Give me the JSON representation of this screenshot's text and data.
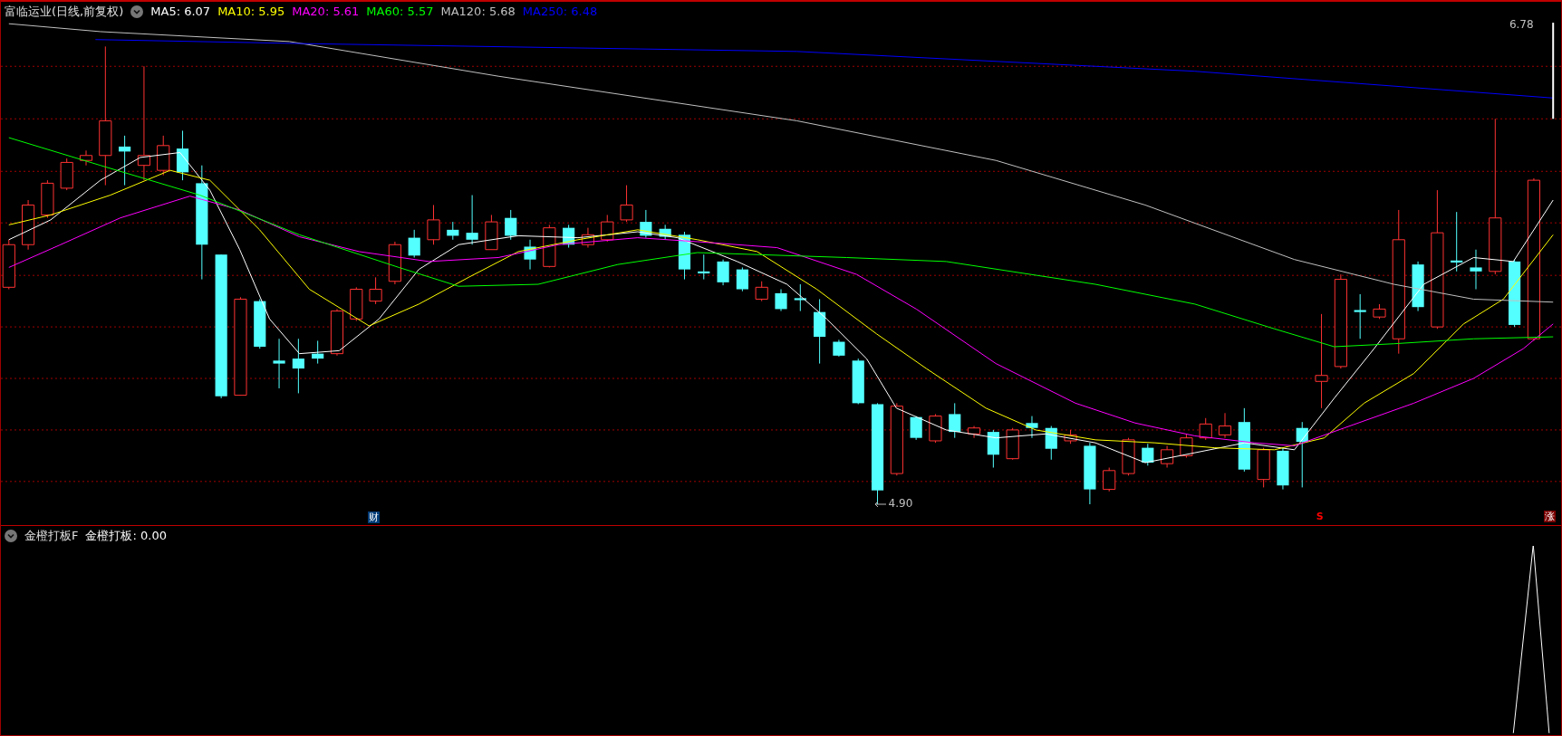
{
  "price_panel": {
    "title": "富临运业(日线,前复权)",
    "moving_averages": [
      {
        "label": "MA5: 6.07",
        "color": "#ffffff"
      },
      {
        "label": "MA10: 5.95",
        "color": "#ffff00"
      },
      {
        "label": "MA20: 5.61",
        "color": "#ff00ff"
      },
      {
        "label": "MA60: 5.57",
        "color": "#00ff00"
      },
      {
        "label": "MA120: 5.68",
        "color": "#c0c0c0"
      },
      {
        "label": "MA250: 6.48",
        "color": "#0000ff"
      }
    ],
    "high_label": "6.78",
    "low_label": "4.90",
    "markers": [
      {
        "kind": "finance",
        "text": "财"
      },
      {
        "kind": "signal",
        "text": "S"
      },
      {
        "kind": "rise",
        "text": "涨"
      }
    ]
  },
  "indicator_panel": {
    "name": "金橙打板F",
    "readout": "金橙打板: 0.00"
  }
}
